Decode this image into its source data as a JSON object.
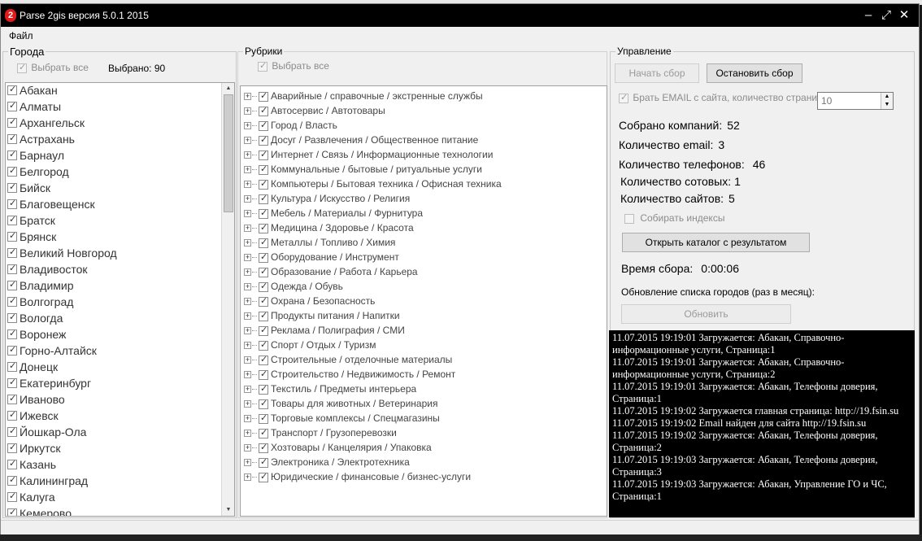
{
  "window": {
    "title": "Parse 2gis версия 5.0.1 2015",
    "icon_glyph": "2",
    "controls": {
      "minimize": "–",
      "maximize": "⤢",
      "close": "✕"
    }
  },
  "menu": {
    "file": "Файл"
  },
  "cities": {
    "group_label": "Города",
    "select_all_label": "Выбрать все",
    "selected_label": "Выбрано:",
    "selected_count": "90",
    "items": [
      "Абакан",
      "Алматы",
      "Архангельск",
      "Астрахань",
      "Барнаул",
      "Белгород",
      "Бийск",
      "Благовещенск",
      "Братск",
      "Брянск",
      "Великий Новгород",
      "Владивосток",
      "Владимир",
      "Волгоград",
      "Вологда",
      "Воронеж",
      "Горно-Алтайск",
      "Донецк",
      "Екатеринбург",
      "Иваново",
      "Ижевск",
      "Йошкар-Ола",
      "Иркутск",
      "Казань",
      "Калининград",
      "Калуга",
      "Кемерово"
    ]
  },
  "rubrics": {
    "group_label": "Рубрики",
    "select_all_label": "Выбрать все",
    "items": [
      "Аварийные / справочные / экстренные службы",
      "Автосервис / Автотовары",
      "Город / Власть",
      "Досуг / Развлечения / Общественное питание",
      "Интернет / Связь / Информационные технологии",
      "Коммунальные / бытовые / ритуальные услуги",
      "Компьютеры / Бытовая техника / Офисная техника",
      "Культура / Искусство / Религия",
      "Мебель / Материалы / Фурнитура",
      "Медицина / Здоровье / Красота",
      "Металлы / Топливо / Химия",
      "Оборудование / Инструмент",
      "Образование / Работа / Карьера",
      "Одежда / Обувь",
      "Охрана / Безопасность",
      "Продукты питания / Напитки",
      "Реклама / Полиграфия / СМИ",
      "Спорт / Отдых / Туризм",
      "Строительные / отделочные материалы",
      "Строительство / Недвижимость / Ремонт",
      "Текстиль / Предметы интерьера",
      "Товары для животных / Ветеринария",
      "Торговые комплексы / Спецмагазины",
      "Транспорт / Грузоперевозки",
      "Хозтовары / Канцелярия / Упаковка",
      "Электроника / Электротехника",
      "Юридические / финансовые / бизнес-услуги"
    ]
  },
  "control": {
    "group_label": "Управление",
    "start_label": "Начать сбор",
    "stop_label": "Остановить сбор",
    "email_label": "Брать EMAIL с сайта, количество страниц:",
    "email_pages": "10",
    "companies_label": "Собрано компаний:",
    "companies_value": "52",
    "email_count_label": "Количество email:",
    "email_count_value": "3",
    "phones_label": "Количество телефонов:",
    "phones_value": "46",
    "mobile_label": "Количество сотовых:",
    "mobile_value": "1",
    "sites_label": "Количество сайтов:",
    "sites_value": "5",
    "indexes_label": "Собирать индексы",
    "open_catalog_label": "Открыть каталог с результатом",
    "time_label": "Время сбора:",
    "time_value": "0:00:06",
    "update_label": "Обновление списка городов (раз в месяц):",
    "update_button": "Обновить"
  },
  "log": [
    "11.07.2015 19:19:01 Загружается: Абакан, Справочно-информационные услуги, Страница:1",
    "11.07.2015 19:19:01 Загружается: Абакан, Справочно-информационные услуги, Страница:2",
    "11.07.2015 19:19:01 Загружается: Абакан, Телефоны доверия, Страница:1",
    "11.07.2015 19:19:02 Загружается главная страница: http://19.fsin.su",
    "11.07.2015 19:19:02 Email найден для сайта http://19.fsin.su",
    "11.07.2015 19:19:02 Загружается: Абакан, Телефоны доверия, Страница:2",
    "11.07.2015 19:19:03 Загружается: Абакан, Телефоны доверия, Страница:3",
    "11.07.2015 19:19:03 Загружается: Абакан, Управление ГО и ЧС, Страница:1"
  ]
}
